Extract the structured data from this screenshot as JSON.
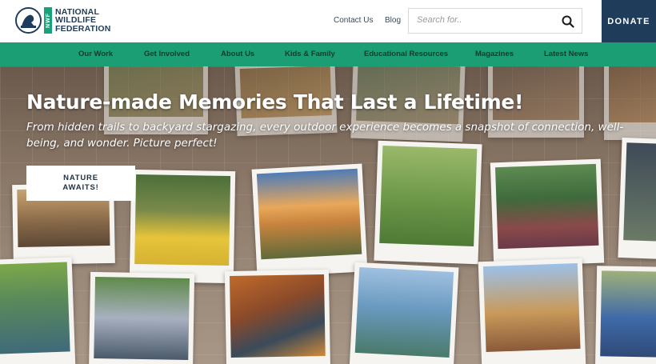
{
  "header": {
    "logo": {
      "line1": "NATIONAL",
      "line2": "WILDLIFE",
      "line3": "FEDERATION",
      "badge": "NWF"
    },
    "links": {
      "contact": "Contact Us",
      "blog": "Blog"
    },
    "search": {
      "placeholder": "Search for..",
      "icon": "search-icon"
    },
    "donate": "DONATE"
  },
  "nav": {
    "items": [
      {
        "label": "Our Work"
      },
      {
        "label": "Get Involved"
      },
      {
        "label": "About Us"
      },
      {
        "label": "Kids & Family"
      },
      {
        "label": "Educational Resources"
      },
      {
        "label": "Magazines"
      },
      {
        "label": "Latest News"
      }
    ]
  },
  "hero": {
    "title": "Nature-made Memories That Last a Lifetime!",
    "subtitle": "From hidden trails to backyard stargazing, every outdoor experience becomes a snapshot of connection, well-being, and wonder. Picture perfect!",
    "cta": {
      "line1": "NATURE",
      "line2": "AWAITS!"
    }
  },
  "colors": {
    "brand_navy": "#1f3c5a",
    "brand_green": "#1b9e73",
    "nav_text": "#13392d"
  }
}
